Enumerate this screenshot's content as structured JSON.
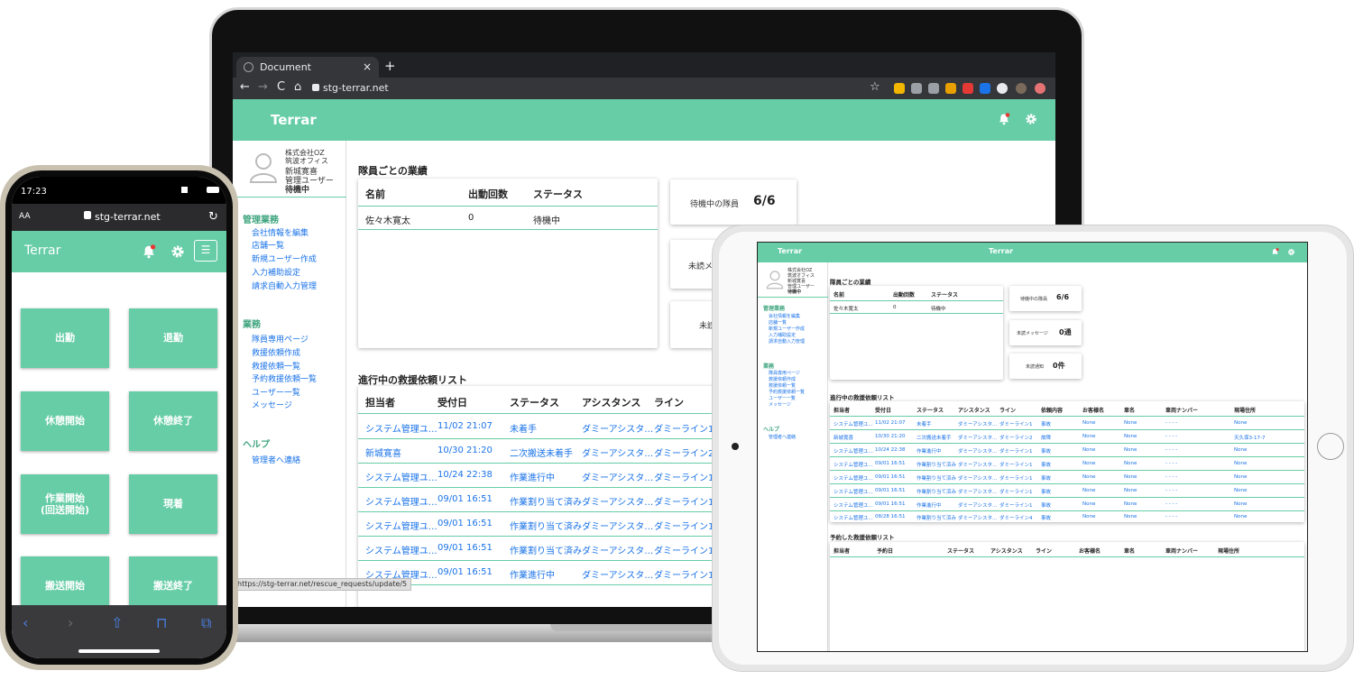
{
  "laptop": {
    "tab_title": "Document",
    "tab_close": "×",
    "new_tab": "+",
    "nav": {
      "back": "←",
      "forward": "→",
      "reload": "C",
      "home": "⌂"
    },
    "url": "stg-terrar.net",
    "star": "☆",
    "app_title": "Terrar",
    "status_url": "https://stg-terrar.net/rescue_requests/update/5",
    "profile": {
      "company": "株式会社OZ",
      "office": "筑波オフィス",
      "name": "新城寛喜",
      "role": "管理ユーザー",
      "state": "待機中"
    },
    "sidebar": {
      "admin_heading": "管理業務",
      "admin_links": [
        "会社情報を編集",
        "店舗一覧",
        "新規ユーザー作成",
        "入力補助設定",
        "請求自動入力管理"
      ],
      "work_heading": "業務",
      "work_links": [
        "隊員専用ページ",
        "救援依頼作成",
        "救援依頼一覧",
        "予約救援依頼一覧",
        "ユーザー一覧",
        "メッセージ"
      ],
      "help_heading": "ヘルプ",
      "help_links": [
        "管理者へ連絡"
      ]
    },
    "performance": {
      "title": "隊員ごとの業績",
      "headers": [
        "名前",
        "出動回数",
        "ステータス"
      ],
      "rows": [
        [
          "佐々木寛太",
          "0",
          "待機中"
        ]
      ]
    },
    "stats": [
      {
        "label": "待機中の隊員",
        "value": "6/6"
      },
      {
        "label": "未読メ",
        "value": ""
      },
      {
        "label": "未読",
        "value": ""
      }
    ],
    "rescue_list": {
      "title": "進行中の救援依頼リスト",
      "headers": [
        "担当者",
        "受付日",
        "ステータス",
        "アシスタンス",
        "ライン"
      ],
      "rows": [
        [
          "システム管理ユ…",
          "11/02 21:07",
          "未着手",
          "ダミーアシスタ…",
          "ダミーライン1"
        ],
        [
          "新城寛喜",
          "10/30 21:20",
          "二次搬送未着手",
          "ダミーアシスタ…",
          "ダミーライン2"
        ],
        [
          "システム管理ユ…",
          "10/24 22:38",
          "作業進行中",
          "ダミーアシスタ…",
          "ダミーライン1"
        ],
        [
          "システム管理ユ…",
          "09/01 16:51",
          "作業割り当て済み",
          "ダミーアシスタ…",
          "ダミーライン1"
        ],
        [
          "システム管理ユ…",
          "09/01 16:51",
          "作業割り当て済み",
          "ダミーアシスタ…",
          "ダミーライン1"
        ],
        [
          "システム管理ユ…",
          "09/01 16:51",
          "作業割り当て済み",
          "ダミーアシスタ…",
          "ダミーライン1"
        ],
        [
          "システム管理ユ…",
          "09/01 16:51",
          "作業進行中",
          "ダミーアシスタ…",
          "ダミーライン1"
        ]
      ]
    }
  },
  "phone": {
    "time": "17:23",
    "aa": "AA",
    "url": "stg-terrar.net",
    "reload": "↻",
    "app_title": "Terrar",
    "menu_icon": "☰",
    "buttons": [
      "出勤",
      "退勤",
      "休憩開始",
      "休憩終了",
      "作業開始\n(回送開始)",
      "現着",
      "搬送開始",
      "搬送終了"
    ],
    "toolbar": {
      "back": "‹",
      "forward": "›",
      "share": "⇧",
      "bookmarks": "⊓",
      "tabs": "⧉"
    }
  },
  "tablet": {
    "app_title_left": "Terrar",
    "app_title_center": "Terrar",
    "profile": {
      "company": "株式会社OZ",
      "office": "筑波オフィス",
      "name": "新城寛喜",
      "role": "管理ユーザー",
      "state": "待機中"
    },
    "sidebar": {
      "admin_heading": "管理業務",
      "admin_links": [
        "会社情報を編集",
        "店舗一覧",
        "新規ユーザー作成",
        "入力補助設定",
        "請求自動入力管理"
      ],
      "work_heading": "業務",
      "work_links": [
        "隊員専用ページ",
        "救援依頼作成",
        "救援依頼一覧",
        "予約救援依頼一覧",
        "ユーザー一覧",
        "メッセージ"
      ],
      "help_heading": "ヘルプ",
      "help_links": [
        "管理者へ連絡"
      ]
    },
    "performance": {
      "title": "隊員ごとの業績",
      "headers": [
        "名前",
        "出動回数",
        "ステータス"
      ],
      "rows": [
        [
          "佐々木寛太",
          "0",
          "待機中"
        ]
      ]
    },
    "stats": [
      {
        "label": "待機中の隊員",
        "value": "6/6"
      },
      {
        "label": "未読メッセージ",
        "value": "0通"
      },
      {
        "label": "未読通知",
        "value": "0件"
      }
    ],
    "rescue_list": {
      "title": "進行中の救援依頼リスト",
      "headers": [
        "担当者",
        "受付日",
        "ステータス",
        "アシスタンス",
        "ライン",
        "依頼内容",
        "お客様名",
        "車名",
        "車両ナンバー",
        "現場住所"
      ],
      "rows": [
        [
          "システム管理ユ…",
          "11/02 21:07",
          "未着手",
          "ダミーアシスタ…",
          "ダミーライン1",
          "事故",
          "None",
          "None",
          "- - - -",
          "None"
        ],
        [
          "新城寛喜",
          "10/30 21:20",
          "二次搬送未着手",
          "ダミーアシスタ…",
          "ダミーライン2",
          "故障",
          "None",
          "None",
          "- - - -",
          "天久保3-17-7"
        ],
        [
          "システム管理ユ…",
          "10/24 22:38",
          "作業進行中",
          "ダミーアシスタ…",
          "ダミーライン1",
          "事故",
          "None",
          "None",
          "- - - -",
          "None"
        ],
        [
          "システム管理ユ…",
          "09/01 16:51",
          "作業割り当て済み",
          "ダミーアシスタ…",
          "ダミーライン1",
          "事故",
          "None",
          "None",
          "- - - -",
          "None"
        ],
        [
          "システム管理ユ…",
          "09/01 16:51",
          "作業割り当て済み",
          "ダミーアシスタ…",
          "ダミーライン1",
          "事故",
          "None",
          "None",
          "- - - -",
          "None"
        ],
        [
          "システム管理ユ…",
          "09/01 16:51",
          "作業割り当て済み",
          "ダミーアシスタ…",
          "ダミーライン1",
          "事故",
          "None",
          "None",
          "- - - -",
          "None"
        ],
        [
          "システム管理ユ…",
          "09/01 16:51",
          "作業進行中",
          "ダミーアシスタ…",
          "ダミーライン1",
          "事故",
          "None",
          "None",
          "- - - -",
          "None"
        ],
        [
          "システム管理ユ…",
          "08/28 16:51",
          "作業割り当て済み",
          "ダミーアシスタ…",
          "ダミーライン4",
          "事故",
          "None",
          "None",
          "- - - -",
          "None"
        ]
      ]
    },
    "reserved_list": {
      "title": "予約した救援依頼リスト",
      "headers": [
        "担当者",
        "予約日",
        "ステータス",
        "アシスタンス",
        "ライン",
        "お客様名",
        "車名",
        "車両ナンバー",
        "現場住所"
      ]
    }
  },
  "colors": {
    "brand": "#66cda6",
    "link": "#1a73e8",
    "heading": "#3fa57f",
    "notification": "#e53935"
  },
  "icons": [
    "bell-icon",
    "gear-icon",
    "avatar-icon",
    "lock-icon",
    "menu-icon",
    "star-icon"
  ]
}
